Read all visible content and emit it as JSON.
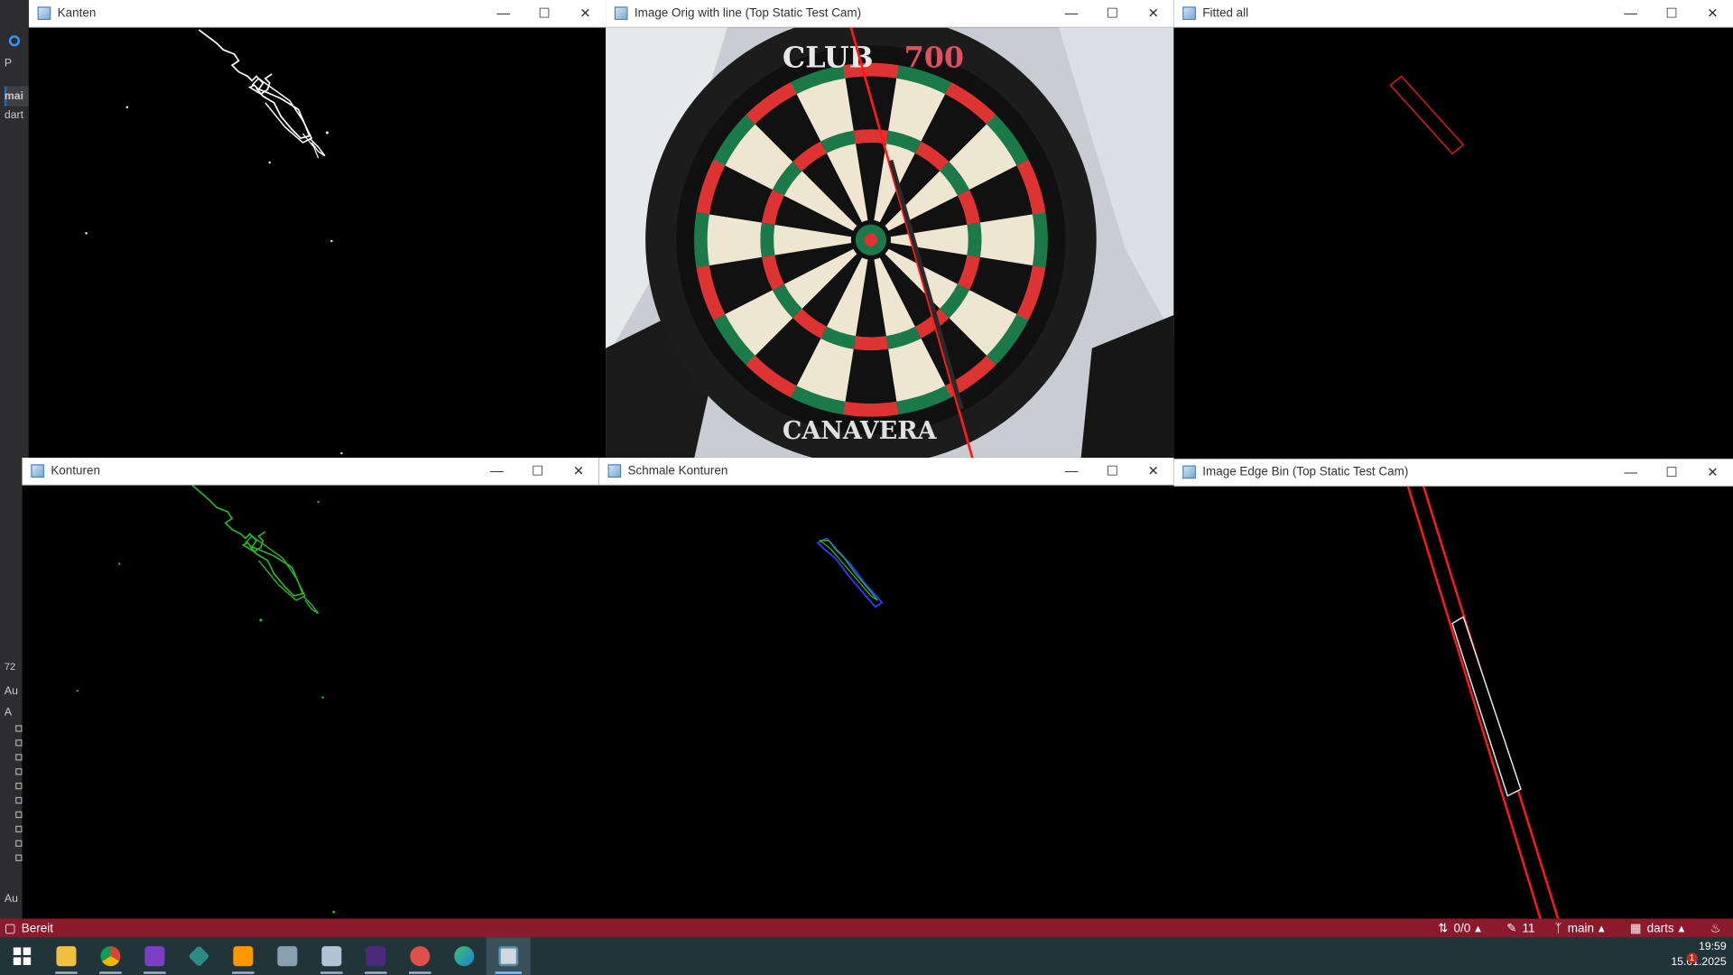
{
  "vs_background": {
    "items": [
      {
        "label": "P"
      },
      {
        "label": "mai"
      },
      {
        "label": "dart"
      },
      {
        "label": "72"
      },
      {
        "label": "Au"
      },
      {
        "label": "A"
      },
      {
        "label": "Au"
      }
    ]
  },
  "windows": [
    {
      "title": "Kanten"
    },
    {
      "title": "Image Orig with line (Top Static Test Cam)"
    },
    {
      "title": "Fitted all"
    },
    {
      "title": "Konturen"
    },
    {
      "title": "Schmale Konturen"
    },
    {
      "title": "Image Edge Bin (Top Static Test Cam)"
    }
  ],
  "dartboard_text": {
    "brand": "CLUB",
    "model": "700",
    "maker": "CANAVERA"
  },
  "statusbar": {
    "status": "Bereit",
    "changes": "0/0",
    "pending": "11",
    "branch": "main",
    "repo": "darts"
  },
  "taskbar": {
    "time": "19:59",
    "date": "15.01.2025",
    "notification_count": "1",
    "apps": [
      {
        "icon": "windows-start-icon"
      },
      {
        "icon": "file-explorer-icon"
      },
      {
        "icon": "chrome-icon"
      },
      {
        "icon": "visual-studio-icon"
      },
      {
        "icon": "git-icon"
      },
      {
        "icon": "sublime-text-icon"
      },
      {
        "icon": "network-app-icon"
      },
      {
        "icon": "remote-desktop-icon"
      },
      {
        "icon": "terminal-icon"
      },
      {
        "icon": "paint-app-icon"
      },
      {
        "icon": "edge-icon"
      },
      {
        "icon": "python-window-icon"
      }
    ]
  },
  "colors": {
    "statusbar": "#8b1a2c",
    "taskbar": "#20343a",
    "fit_line": "#ff1a1a",
    "contour_green": "#22c022"
  }
}
